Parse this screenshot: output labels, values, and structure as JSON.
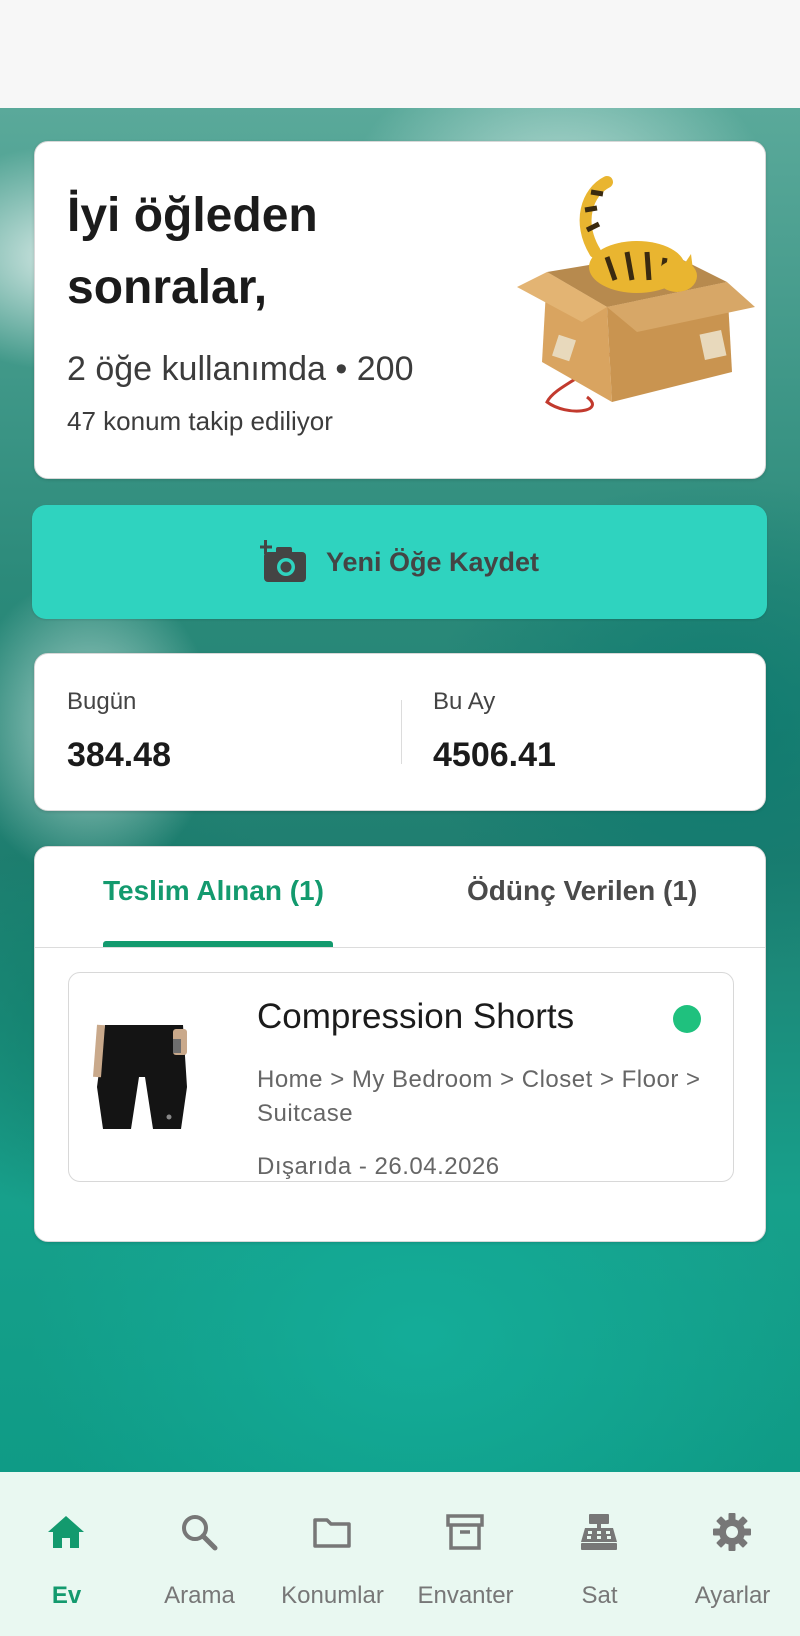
{
  "greeting": {
    "title": "İyi öğleden sonralar,",
    "summary": "2 öğe kullanımda • 200",
    "summary_line2": "47 konum takip ediliyor"
  },
  "actions": {
    "save_label": "Yeni Öğe Kaydet"
  },
  "stats": {
    "today_label": "Bugün",
    "today_value": "384.48",
    "month_label": "Bu Ay",
    "month_value": "4506.41"
  },
  "tabs": [
    {
      "label": "Teslim Alınan (1)",
      "active": true
    },
    {
      "label": "Ödünç Verilen (1)",
      "active": false
    }
  ],
  "items": [
    {
      "name": "Compression Shorts",
      "path": "Home > My Bedroom > Closet > Floor > Suitcase",
      "status": "Dışarıda - 26.04.2026",
      "status_color": "#1fc17e"
    }
  ],
  "nav": [
    {
      "label": "Ev",
      "icon": "home-icon",
      "active": true
    },
    {
      "label": "Arama",
      "icon": "search-icon",
      "active": false
    },
    {
      "label": "Konumlar",
      "icon": "folder-icon",
      "active": false
    },
    {
      "label": "Envanter",
      "icon": "archive-icon",
      "active": false
    },
    {
      "label": "Sat",
      "icon": "cash-register-icon",
      "active": false
    },
    {
      "label": "Ayarlar",
      "icon": "gear-icon",
      "active": false
    }
  ],
  "colors": {
    "accent": "#139a6e",
    "button": "#2fd3bf",
    "nav_background": "#e9f8f1"
  }
}
